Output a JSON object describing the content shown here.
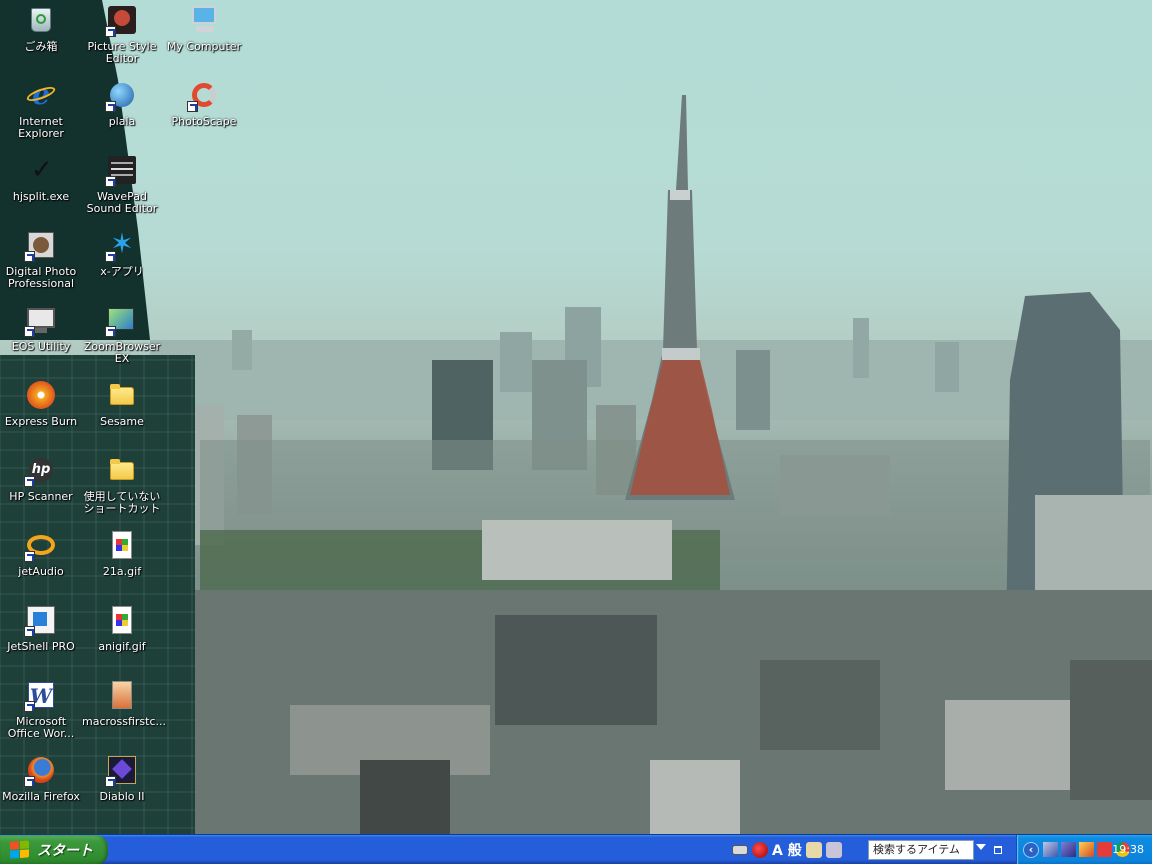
{
  "desktop": {
    "icons": [
      {
        "label": "ごみ箱",
        "icon": "recycle-bin-icon",
        "shortcut": false
      },
      {
        "label": "Picture Style Editor",
        "icon": "picture-style-editor-icon",
        "shortcut": true
      },
      {
        "label": "My Computer",
        "icon": "my-computer-icon",
        "shortcut": false
      },
      {
        "label": "Internet Explorer",
        "icon": "internet-explorer-icon",
        "shortcut": false
      },
      {
        "label": "plala",
        "icon": "plala-icon",
        "shortcut": true
      },
      {
        "label": "PhotoScape",
        "icon": "photoscape-icon",
        "shortcut": true
      },
      {
        "label": "hjsplit.exe",
        "icon": "hjsplit-checkmark-icon",
        "shortcut": false
      },
      {
        "label": "WavePad Sound Editor",
        "icon": "wavepad-icon",
        "shortcut": true
      },
      {
        "label": "Digital Photo Professional",
        "icon": "digital-photo-professional-icon",
        "shortcut": true
      },
      {
        "label": "x-アプリ",
        "icon": "x-app-icon",
        "shortcut": true
      },
      {
        "label": "EOS Utility",
        "icon": "eos-utility-icon",
        "shortcut": true
      },
      {
        "label": "ZoomBrowser EX",
        "icon": "zoombrowser-icon",
        "shortcut": true
      },
      {
        "label": "Express Burn",
        "icon": "express-burn-icon",
        "shortcut": false
      },
      {
        "label": "Sesame",
        "icon": "folder-icon",
        "shortcut": false
      },
      {
        "label": "HP Scanner",
        "icon": "hp-scanner-icon",
        "shortcut": true
      },
      {
        "label": "使用していない ショートカット",
        "icon": "folder-icon",
        "shortcut": false
      },
      {
        "label": "jetAudio",
        "icon": "jetaudio-icon",
        "shortcut": true
      },
      {
        "label": "21a.gif",
        "icon": "gif-file-icon",
        "shortcut": false
      },
      {
        "label": "JetShell PRO",
        "icon": "jetshell-pro-icon",
        "shortcut": true
      },
      {
        "label": "anigif.gif",
        "icon": "gif-file-icon",
        "shortcut": false
      },
      {
        "label": "Microsoft Office Wor...",
        "icon": "word-icon",
        "shortcut": true
      },
      {
        "label": "macrossfirstc...",
        "icon": "image-file-icon",
        "shortcut": false
      },
      {
        "label": "Mozilla Firefox",
        "icon": "firefox-icon",
        "shortcut": true
      },
      {
        "label": "Diablo II",
        "icon": "diablo-ii-icon",
        "shortcut": true
      }
    ]
  },
  "taskbar": {
    "start_label": "スタート",
    "ime_mode_label": "A 般",
    "search_placeholder": "検索するアイテム",
    "clock": "19:38",
    "colors": {
      "taskbar": "#245edb",
      "start": "#3c9a3c",
      "tray": "#0c83dc"
    }
  }
}
